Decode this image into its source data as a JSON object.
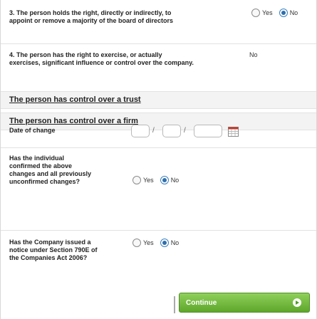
{
  "questions": {
    "q3": {
      "text": "3. The person holds the right, directly or indirectly, to appoint or remove a majority of the board of directors",
      "options": [
        {
          "label": "Yes",
          "selected": false
        },
        {
          "label": "No",
          "selected": true
        }
      ]
    },
    "q4": {
      "text": "4. The person has the right to exercise, or actually exercises, significant influence or control over the company.",
      "value": "No"
    }
  },
  "sections": {
    "trust_link": "The person has control over a trust",
    "firm_link": "The person has control over a firm"
  },
  "date_of_change": {
    "label": "Date of change",
    "separator": "/",
    "icon": "calendar-icon"
  },
  "confirm": {
    "text": "Has the individual confirmed the above changes and all previously unconfirmed changes?",
    "options": [
      {
        "label": "Yes",
        "selected": false
      },
      {
        "label": "No",
        "selected": true
      }
    ]
  },
  "notice": {
    "text": "Has the Company issued a notice under Section 790E of the Companies Act 2006?",
    "options": [
      {
        "label": "Yes",
        "selected": false
      },
      {
        "label": "No",
        "selected": true
      }
    ]
  },
  "footer": {
    "continue_label": "Continue",
    "icon": "arrow-right-icon"
  },
  "colors": {
    "button_green": "#5ea62c",
    "radio_blue": "#2e6fae"
  }
}
